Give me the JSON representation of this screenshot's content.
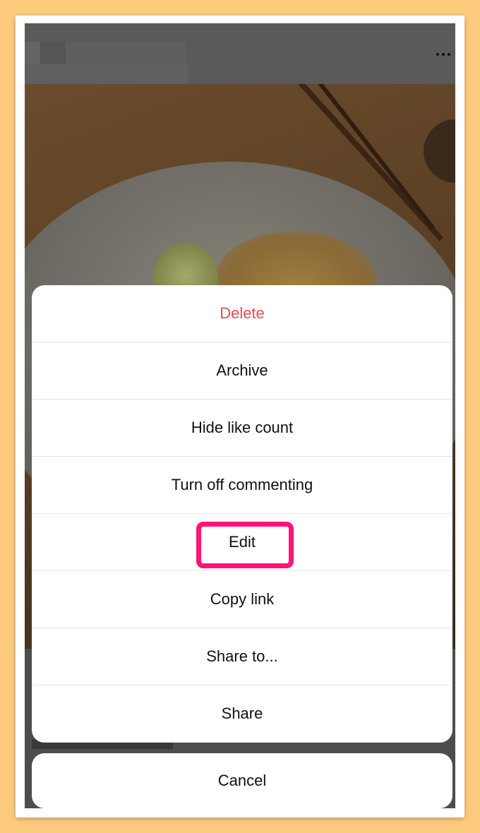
{
  "menu": {
    "items": [
      {
        "label": "Delete",
        "style": "danger"
      },
      {
        "label": "Archive"
      },
      {
        "label": "Hide like count"
      },
      {
        "label": "Turn off commenting"
      },
      {
        "label": "Edit",
        "highlighted": true
      },
      {
        "label": "Copy link"
      },
      {
        "label": "Share to..."
      },
      {
        "label": "Share"
      }
    ],
    "cancel_label": "Cancel"
  },
  "header": {
    "more_icon": "more-horizontal-icon"
  },
  "colors": {
    "danger": "#ed4956",
    "highlight": "#ff1477",
    "background": "#fdcb7e"
  }
}
